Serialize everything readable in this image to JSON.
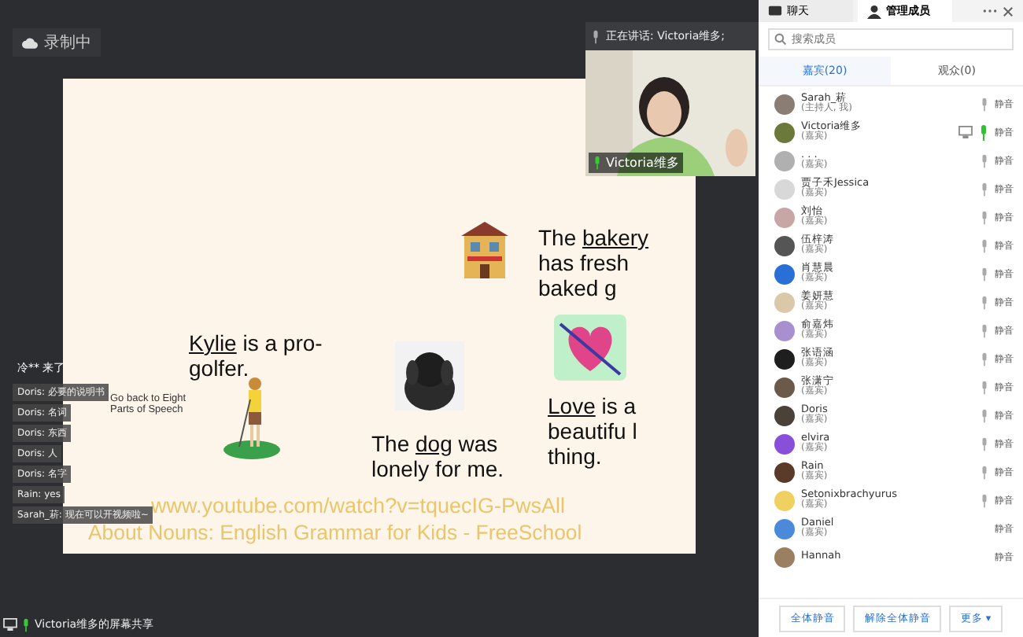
{
  "recording": {
    "label": "录制中"
  },
  "speaking": {
    "label": "正在讲话: Victoria维多;"
  },
  "video": {
    "kind": "picture",
    "name": "Victoria维多"
  },
  "slide": {
    "notes": [
      {
        "kind": "sentence",
        "underlined": "Kylie",
        "after": " is a pro-golfer."
      },
      {
        "kind": "sentence",
        "before": "The ",
        "underlined": "dog",
        "after": " was lonely for me."
      },
      {
        "kind": "sentence",
        "before": "The ",
        "underlined": "bakery",
        "after": " has fresh baked g"
      },
      {
        "kind": "sentence",
        "underlined": "Love",
        "after": " is a beautifu l thing."
      }
    ],
    "back_link": "Go back to Eight Parts of Speech",
    "source_url": "www.youtube.com/watch?v=tquecIG-PwsAll",
    "source_title": "About Nouns: English Grammar for Kids - FreeSchool"
  },
  "chat": [
    {
      "text": "冷** 来了"
    },
    {
      "text": "Doris: 必要的说明书"
    },
    {
      "text": "Doris: 名词"
    },
    {
      "text": "Doris: 东西"
    },
    {
      "text": "Doris: 人"
    },
    {
      "text": "Doris: 名字"
    },
    {
      "text": "Rain: yes"
    },
    {
      "text": "Sarah_菥: 现在可以开视频啦~"
    }
  ],
  "share_label": "Victoria维多的屏幕共享",
  "panel": {
    "tabs": [
      {
        "label": "聊天",
        "selected": false
      },
      {
        "label": "管理成员",
        "selected": true
      }
    ],
    "search": {
      "placeholder": "搜索成员"
    },
    "subtabs": [
      {
        "label": "嘉宾(20)",
        "selected": true
      },
      {
        "label": "观众(0)",
        "selected": false
      }
    ],
    "members": [
      {
        "name": "Sarah_菥",
        "role": "(主持人, 我)",
        "mic": true,
        "talking": false,
        "sharing": false,
        "action": "静音",
        "color": "#8a7d74"
      },
      {
        "name": "Victoria维多",
        "role": "(嘉宾)",
        "mic": true,
        "talking": true,
        "sharing": true,
        "action": "静音",
        "color": "#6b7a3a"
      },
      {
        "name": ". . .",
        "role": "(嘉宾)",
        "mic": true,
        "talking": false,
        "sharing": false,
        "action": "静音",
        "color": "#b0b0b0"
      },
      {
        "name": "贾子禾Jessica",
        "role": "(嘉宾)",
        "mic": true,
        "talking": false,
        "sharing": false,
        "action": "静音",
        "color": "#d8d8d8"
      },
      {
        "name": "刘怡",
        "role": "(嘉宾)",
        "mic": true,
        "talking": false,
        "sharing": false,
        "action": "静音",
        "color": "#c9a6a6"
      },
      {
        "name": "伍梓涛",
        "role": "(嘉宾)",
        "mic": true,
        "talking": false,
        "sharing": false,
        "action": "静音",
        "color": "#555555"
      },
      {
        "name": "肖慧晨",
        "role": "(嘉宾)",
        "mic": true,
        "talking": false,
        "sharing": false,
        "action": "静音",
        "color": "#2a6fd6"
      },
      {
        "name": "姜妍慧",
        "role": "(嘉宾)",
        "mic": true,
        "talking": false,
        "sharing": false,
        "action": "静音",
        "color": "#d9c9a8"
      },
      {
        "name": "俞嘉炜",
        "role": "(嘉宾)",
        "mic": true,
        "talking": false,
        "sharing": false,
        "action": "静音",
        "color": "#a88fd0"
      },
      {
        "name": "张语涵",
        "role": "(嘉宾)",
        "mic": true,
        "talking": false,
        "sharing": false,
        "action": "静音",
        "color": "#1e1e1e"
      },
      {
        "name": "张潇宁",
        "role": "(嘉宾)",
        "mic": true,
        "talking": false,
        "sharing": false,
        "action": "静音",
        "color": "#6b5a4a"
      },
      {
        "name": "Doris",
        "role": "(嘉宾)",
        "mic": true,
        "talking": false,
        "sharing": false,
        "action": "静音",
        "color": "#4a4238"
      },
      {
        "name": "elvira",
        "role": "(嘉宾)",
        "mic": true,
        "talking": false,
        "sharing": false,
        "action": "静音",
        "color": "#8a4fd8"
      },
      {
        "name": "Rain",
        "role": "(嘉宾)",
        "mic": true,
        "talking": false,
        "sharing": false,
        "action": "静音",
        "color": "#5a3a28"
      },
      {
        "name": "Setonixbrachyurus",
        "role": "(嘉宾)",
        "mic": true,
        "talking": false,
        "sharing": false,
        "action": "静音",
        "color": "#f0d060"
      },
      {
        "name": "Daniel",
        "role": "(嘉宾)",
        "mic": false,
        "sharing": false,
        "action": "静音",
        "color": "#4a8ad8"
      },
      {
        "name": "Hannah",
        "mic": false,
        "sharing": false,
        "action": "静音",
        "color": "#9a8060"
      }
    ],
    "buttons": [
      "全体静音",
      "解除全体静音",
      "更多 ▾"
    ]
  }
}
